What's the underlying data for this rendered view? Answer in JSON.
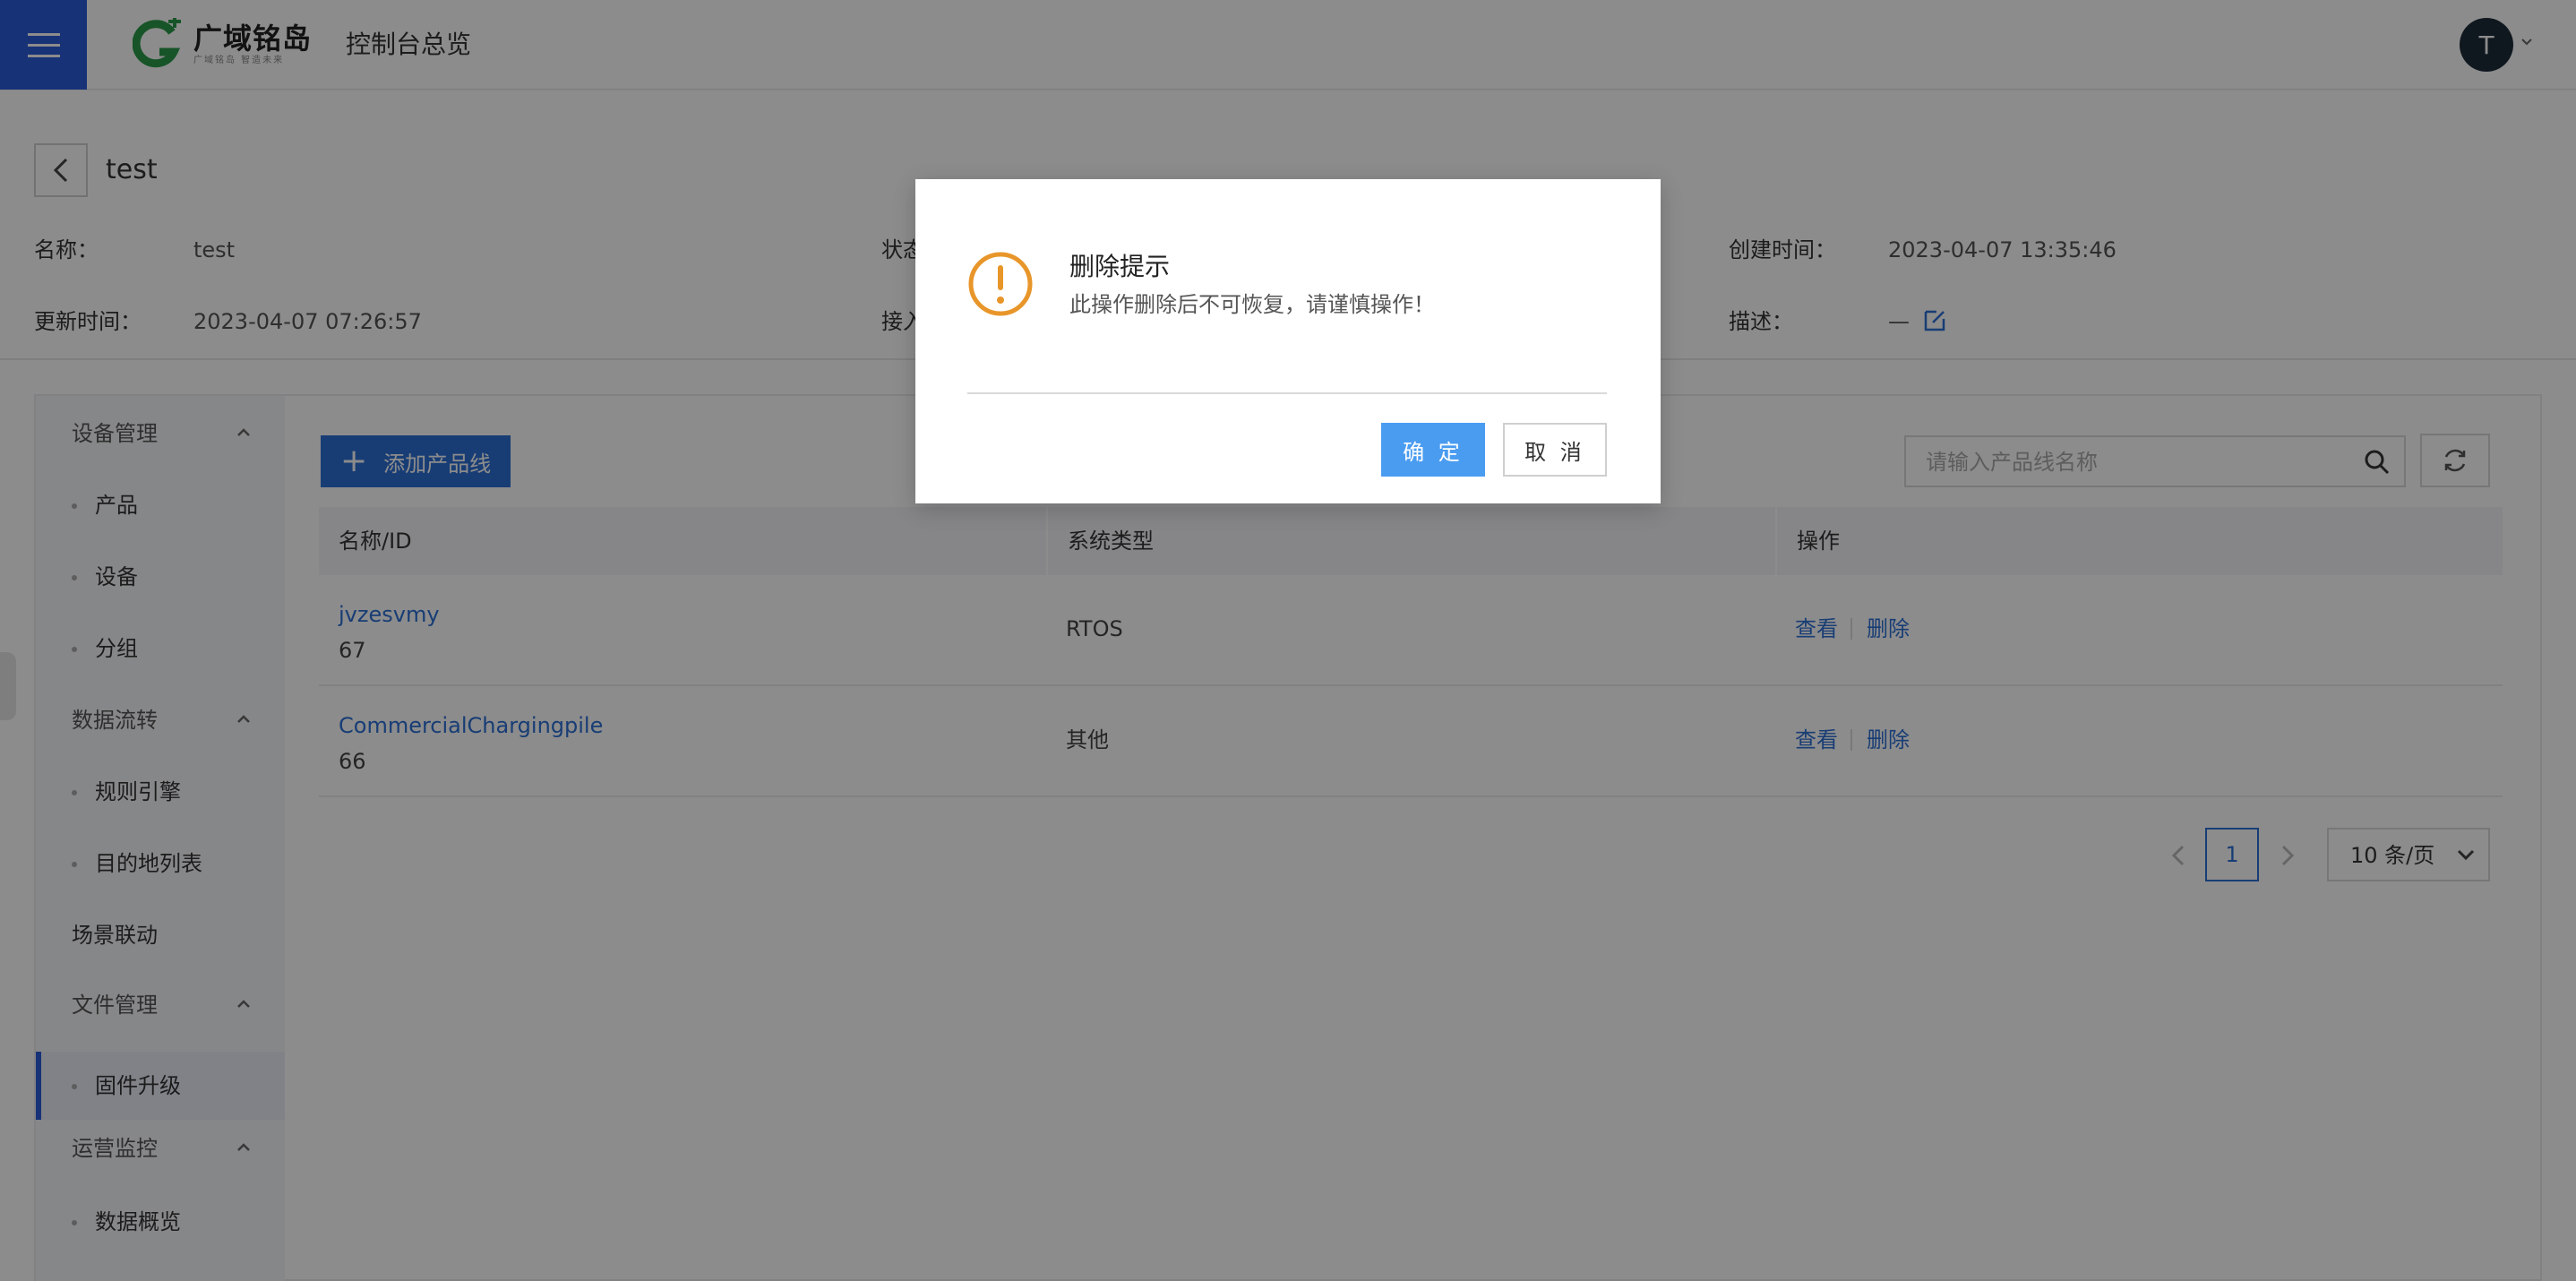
{
  "header": {
    "brand_main": "广域铭岛",
    "brand_sub": "广域铭岛 智造未来",
    "console_title": "控制台总览",
    "avatar_initial": "T",
    "accent_color": "#2c5cdb"
  },
  "detail": {
    "title": "test",
    "fields": {
      "name_label": "名称：",
      "name_value": "test",
      "status_label": "状态",
      "created_label": "创建时间：",
      "created_value": "2023-04-07 13:35:46",
      "updated_label": "更新时间：",
      "updated_value": "2023-04-07 07:26:57",
      "access_label": "接入",
      "desc_label": "描述：",
      "desc_value": "—"
    }
  },
  "sidebar": {
    "groups": [
      {
        "label": "设备管理",
        "items": [
          "产品",
          "设备",
          "分组"
        ]
      },
      {
        "label": "数据流转",
        "items": [
          "规则引擎",
          "目的地列表"
        ]
      },
      {
        "label": "场景联动",
        "items": []
      },
      {
        "label": "文件管理",
        "items": [
          "固件升级"
        ]
      },
      {
        "label": "运营监控",
        "items": [
          "数据概览"
        ]
      }
    ],
    "active_item": "固件升级"
  },
  "toolbar": {
    "add_label": "添加产品线",
    "search_placeholder": "请输入产品线名称"
  },
  "table": {
    "headers": [
      "名称/ID",
      "系统类型",
      "操作"
    ],
    "rows": [
      {
        "name": "jvzesvmy",
        "id": "67",
        "type": "RTOS",
        "view": "查看",
        "delete": "删除"
      },
      {
        "name": "CommercialChargingpile",
        "id": "66",
        "type": "其他",
        "view": "查看",
        "delete": "删除"
      }
    ]
  },
  "pagination": {
    "current_page": "1",
    "page_size": "10 条/页"
  },
  "modal": {
    "title": "删除提示",
    "message": "此操作删除后不可恢复，请谨慎操作！",
    "ok_label": "确 定",
    "cancel_label": "取 消",
    "icon_color": "#e8962a",
    "ok_color": "#4a9cf0"
  }
}
